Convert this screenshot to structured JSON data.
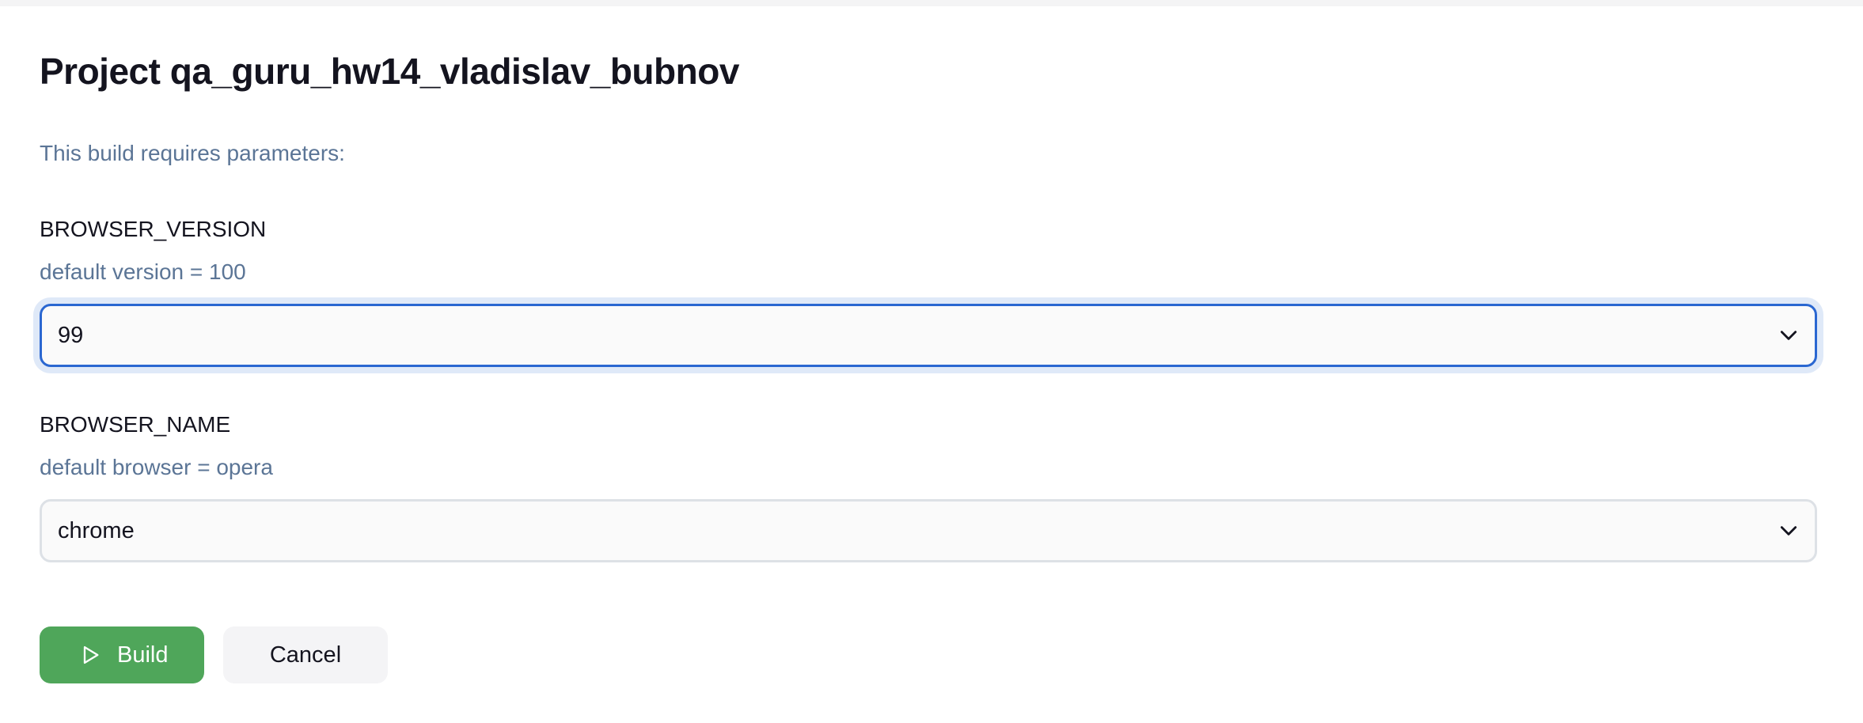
{
  "page": {
    "title": "Project qa_guru_hw14_vladislav_bubnov",
    "subtitle": "This build requires parameters:"
  },
  "parameters": [
    {
      "name": "BROWSER_VERSION",
      "description": "default version = 100",
      "selected_value": "99",
      "focused": true
    },
    {
      "name": "BROWSER_NAME",
      "description": "default browser = opera",
      "selected_value": "chrome",
      "focused": false
    }
  ],
  "actions": {
    "build_label": "Build",
    "build_icon": "play-icon",
    "cancel_label": "Cancel"
  },
  "colors": {
    "build_button": "#4fa65a",
    "focus_border": "#2a67d1",
    "muted_text": "#5b7596"
  }
}
